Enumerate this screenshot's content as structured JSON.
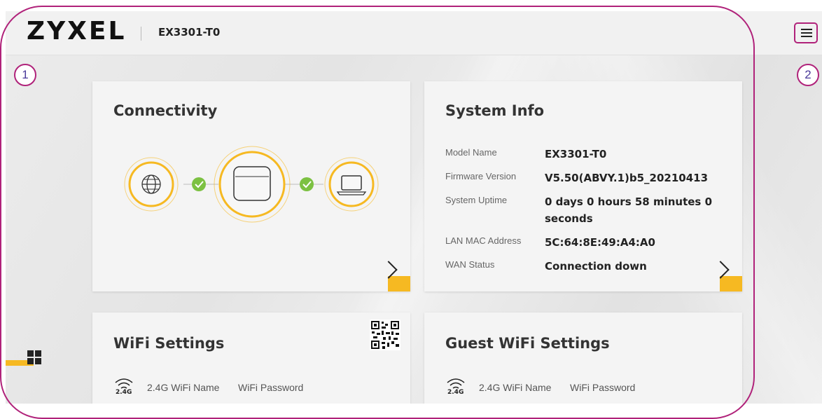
{
  "header": {
    "brand": "ZYXEL",
    "model": "EX3301-T0",
    "menu_icon": "hamburger-menu-icon"
  },
  "connectivity": {
    "title": "Connectivity",
    "nodes": [
      "globe-icon",
      "router-icon",
      "laptop-icon"
    ],
    "status_icon": "check-circle-icon"
  },
  "system_info": {
    "title": "System Info",
    "rows": [
      {
        "label": "Model Name",
        "value": "EX3301-T0"
      },
      {
        "label": "Firmware Version",
        "value": "V5.50(ABVY.1)b5_20210413"
      },
      {
        "label": "System Uptime",
        "value": "0 days 0 hours 58 minutes 0 seconds"
      },
      {
        "label": "LAN MAC Address",
        "value": "5C:64:8E:49:A4:A0"
      },
      {
        "label": "WAN Status",
        "value": "Connection down"
      }
    ]
  },
  "wifi_settings": {
    "title": "WiFi Settings",
    "band": "2.4G",
    "col_name": "2.4G WiFi Name",
    "col_password": "WiFi Password"
  },
  "guest_wifi_settings": {
    "title": "Guest WiFi Settings",
    "band": "2.4G",
    "col_name": "2.4G WiFi Name",
    "col_password": "WiFi Password"
  },
  "annotations": {
    "marker1": "1",
    "marker2": "2"
  },
  "colors": {
    "accent_yellow": "#f6b922",
    "status_green": "#7cc142",
    "annotation_magenta": "#b0227a"
  }
}
